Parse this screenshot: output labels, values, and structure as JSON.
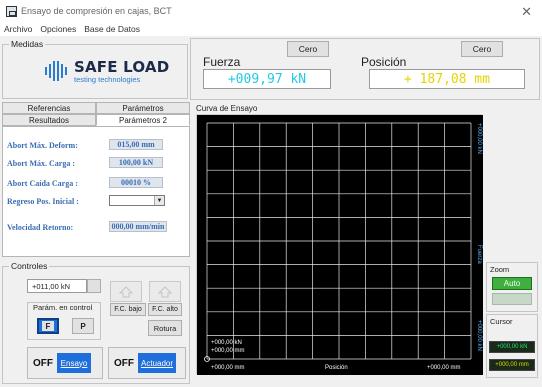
{
  "window": {
    "title": "Ensayo de compresión en cajas, BCT",
    "close_glyph": "✕"
  },
  "menu": [
    "Archivo",
    "Opciones",
    "Base de Datos"
  ],
  "medidas": {
    "label": "Medidas",
    "logo_title": "SAFE LOAD",
    "logo_sub": "testing technologies",
    "fuerza_label": "Fuerza",
    "fuerza_value": "+009,97 kN",
    "posicion_label": "Posición",
    "posicion_value": "+ 187,08 mm",
    "cero_label": "Cero"
  },
  "tabs": {
    "row1": [
      "Referencias",
      "Parámetros"
    ],
    "row2": [
      "Resultados",
      "Parámetros 2"
    ]
  },
  "params": [
    {
      "label": "Abort Máx. Deform:",
      "value": "015,00 mm"
    },
    {
      "label": "Abort Máx. Carga :",
      "value": "100,00 kN"
    },
    {
      "label": "Abort Caída Carga :",
      "value": "00010 %"
    },
    {
      "label": "Regreso Pos. Inicial :",
      "value": ""
    },
    {
      "label": "Velocidad Retorno:",
      "value": "000,00 mm/min"
    }
  ],
  "chart": {
    "title": "Curva de Ensayo",
    "y_top_label": "+000,00 kN",
    "y_bottom_label": "+000,00 kN",
    "y_axis_name": "Fuerza",
    "x_axis_name": "Posición",
    "corner_lines": [
      "+000,00 kN",
      "+000,00 mm"
    ],
    "x_left_label": "+000,00 mm",
    "x_right_label": "+000,00 mm",
    "colors": {
      "background": "#000000",
      "grid": "#e8e8e8",
      "labels": "#5fb0f0"
    }
  },
  "controles": {
    "label": "Controles",
    "setpoint_value": "+011,00 kN",
    "param_group_label": "Parám. en control",
    "f_label": "F",
    "p_label": "P",
    "fc_bajo": "F.C. bajo",
    "fc_alto": "F.C. alto",
    "rotura": "Rotura",
    "ensayo_off": "OFF",
    "ensayo_label": "Ensayo",
    "actuador_off": "OFF",
    "actuador_label": "Actuador"
  },
  "zoom": {
    "label": "Zoom",
    "auto_label": "Auto"
  },
  "cursor": {
    "label": "Cursor",
    "value1": "+000,00 kN",
    "value2": "+000,00 mm"
  }
}
